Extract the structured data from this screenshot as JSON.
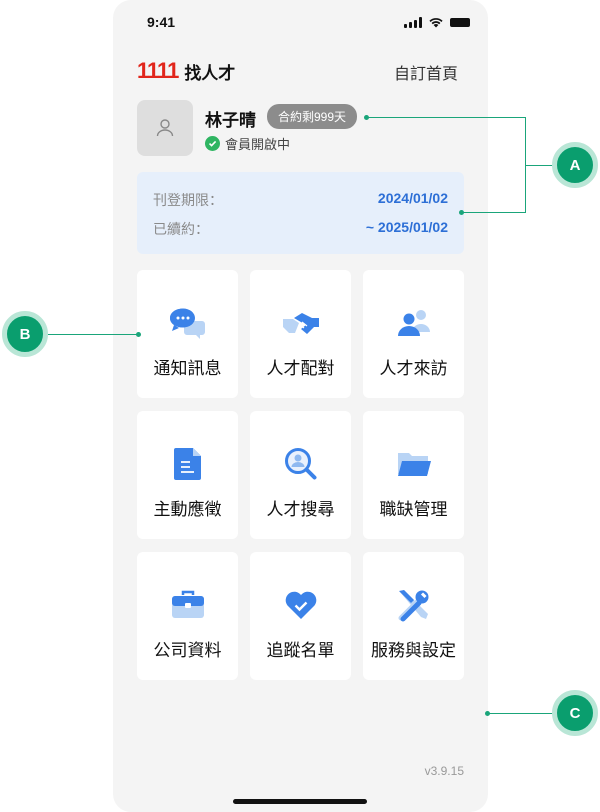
{
  "status_bar": {
    "time": "9:41"
  },
  "header": {
    "logo_number": "1111",
    "logo_text": "找人才",
    "custom_home": "自訂首頁"
  },
  "profile": {
    "name": "林子晴",
    "contract_badge": "合約剩999天",
    "status": "會員開啟中"
  },
  "period": {
    "publish_label": "刊登期限：",
    "publish_date": "2024/01/02",
    "renew_label": "已續約：",
    "renew_date": "~ 2025/01/02"
  },
  "menu": [
    {
      "label": "通知訊息",
      "icon": "chat-bubbles-icon"
    },
    {
      "label": "人才配對",
      "icon": "handshake-icon"
    },
    {
      "label": "人才來訪",
      "icon": "visitors-icon"
    },
    {
      "label": "主動應徵",
      "icon": "document-icon"
    },
    {
      "label": "人才搜尋",
      "icon": "search-person-icon"
    },
    {
      "label": "職缺管理",
      "icon": "folder-icon"
    },
    {
      "label": "公司資料",
      "icon": "briefcase-icon"
    },
    {
      "label": "追蹤名單",
      "icon": "heart-check-icon"
    },
    {
      "label": "服務與設定",
      "icon": "tools-icon"
    }
  ],
  "version": "v3.9.15",
  "callouts": {
    "a": "A",
    "b": "B",
    "c": "C"
  },
  "colors": {
    "brand_red": "#e1251b",
    "accent_blue": "#2d6fd6",
    "callout_green": "#0a9e6e"
  }
}
